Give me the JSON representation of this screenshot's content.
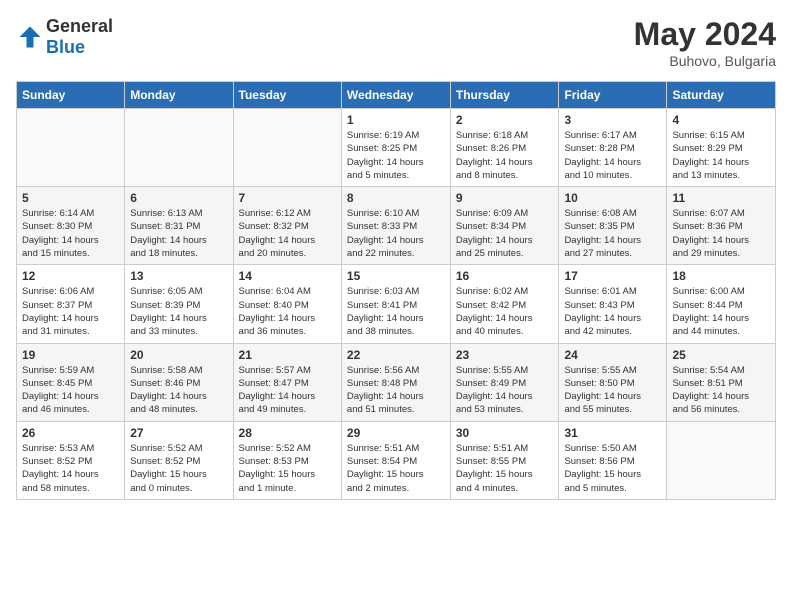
{
  "header": {
    "logo_general": "General",
    "logo_blue": "Blue",
    "month_year": "May 2024",
    "location": "Buhovo, Bulgaria"
  },
  "weekdays": [
    "Sunday",
    "Monday",
    "Tuesday",
    "Wednesday",
    "Thursday",
    "Friday",
    "Saturday"
  ],
  "weeks": [
    [
      {
        "day": "",
        "info": ""
      },
      {
        "day": "",
        "info": ""
      },
      {
        "day": "",
        "info": ""
      },
      {
        "day": "1",
        "info": "Sunrise: 6:19 AM\nSunset: 8:25 PM\nDaylight: 14 hours\nand 5 minutes."
      },
      {
        "day": "2",
        "info": "Sunrise: 6:18 AM\nSunset: 8:26 PM\nDaylight: 14 hours\nand 8 minutes."
      },
      {
        "day": "3",
        "info": "Sunrise: 6:17 AM\nSunset: 8:28 PM\nDaylight: 14 hours\nand 10 minutes."
      },
      {
        "day": "4",
        "info": "Sunrise: 6:15 AM\nSunset: 8:29 PM\nDaylight: 14 hours\nand 13 minutes."
      }
    ],
    [
      {
        "day": "5",
        "info": "Sunrise: 6:14 AM\nSunset: 8:30 PM\nDaylight: 14 hours\nand 15 minutes."
      },
      {
        "day": "6",
        "info": "Sunrise: 6:13 AM\nSunset: 8:31 PM\nDaylight: 14 hours\nand 18 minutes."
      },
      {
        "day": "7",
        "info": "Sunrise: 6:12 AM\nSunset: 8:32 PM\nDaylight: 14 hours\nand 20 minutes."
      },
      {
        "day": "8",
        "info": "Sunrise: 6:10 AM\nSunset: 8:33 PM\nDaylight: 14 hours\nand 22 minutes."
      },
      {
        "day": "9",
        "info": "Sunrise: 6:09 AM\nSunset: 8:34 PM\nDaylight: 14 hours\nand 25 minutes."
      },
      {
        "day": "10",
        "info": "Sunrise: 6:08 AM\nSunset: 8:35 PM\nDaylight: 14 hours\nand 27 minutes."
      },
      {
        "day": "11",
        "info": "Sunrise: 6:07 AM\nSunset: 8:36 PM\nDaylight: 14 hours\nand 29 minutes."
      }
    ],
    [
      {
        "day": "12",
        "info": "Sunrise: 6:06 AM\nSunset: 8:37 PM\nDaylight: 14 hours\nand 31 minutes."
      },
      {
        "day": "13",
        "info": "Sunrise: 6:05 AM\nSunset: 8:39 PM\nDaylight: 14 hours\nand 33 minutes."
      },
      {
        "day": "14",
        "info": "Sunrise: 6:04 AM\nSunset: 8:40 PM\nDaylight: 14 hours\nand 36 minutes."
      },
      {
        "day": "15",
        "info": "Sunrise: 6:03 AM\nSunset: 8:41 PM\nDaylight: 14 hours\nand 38 minutes."
      },
      {
        "day": "16",
        "info": "Sunrise: 6:02 AM\nSunset: 8:42 PM\nDaylight: 14 hours\nand 40 minutes."
      },
      {
        "day": "17",
        "info": "Sunrise: 6:01 AM\nSunset: 8:43 PM\nDaylight: 14 hours\nand 42 minutes."
      },
      {
        "day": "18",
        "info": "Sunrise: 6:00 AM\nSunset: 8:44 PM\nDaylight: 14 hours\nand 44 minutes."
      }
    ],
    [
      {
        "day": "19",
        "info": "Sunrise: 5:59 AM\nSunset: 8:45 PM\nDaylight: 14 hours\nand 46 minutes."
      },
      {
        "day": "20",
        "info": "Sunrise: 5:58 AM\nSunset: 8:46 PM\nDaylight: 14 hours\nand 48 minutes."
      },
      {
        "day": "21",
        "info": "Sunrise: 5:57 AM\nSunset: 8:47 PM\nDaylight: 14 hours\nand 49 minutes."
      },
      {
        "day": "22",
        "info": "Sunrise: 5:56 AM\nSunset: 8:48 PM\nDaylight: 14 hours\nand 51 minutes."
      },
      {
        "day": "23",
        "info": "Sunrise: 5:55 AM\nSunset: 8:49 PM\nDaylight: 14 hours\nand 53 minutes."
      },
      {
        "day": "24",
        "info": "Sunrise: 5:55 AM\nSunset: 8:50 PM\nDaylight: 14 hours\nand 55 minutes."
      },
      {
        "day": "25",
        "info": "Sunrise: 5:54 AM\nSunset: 8:51 PM\nDaylight: 14 hours\nand 56 minutes."
      }
    ],
    [
      {
        "day": "26",
        "info": "Sunrise: 5:53 AM\nSunset: 8:52 PM\nDaylight: 14 hours\nand 58 minutes."
      },
      {
        "day": "27",
        "info": "Sunrise: 5:52 AM\nSunset: 8:52 PM\nDaylight: 15 hours\nand 0 minutes."
      },
      {
        "day": "28",
        "info": "Sunrise: 5:52 AM\nSunset: 8:53 PM\nDaylight: 15 hours\nand 1 minute."
      },
      {
        "day": "29",
        "info": "Sunrise: 5:51 AM\nSunset: 8:54 PM\nDaylight: 15 hours\nand 2 minutes."
      },
      {
        "day": "30",
        "info": "Sunrise: 5:51 AM\nSunset: 8:55 PM\nDaylight: 15 hours\nand 4 minutes."
      },
      {
        "day": "31",
        "info": "Sunrise: 5:50 AM\nSunset: 8:56 PM\nDaylight: 15 hours\nand 5 minutes."
      },
      {
        "day": "",
        "info": ""
      }
    ]
  ]
}
